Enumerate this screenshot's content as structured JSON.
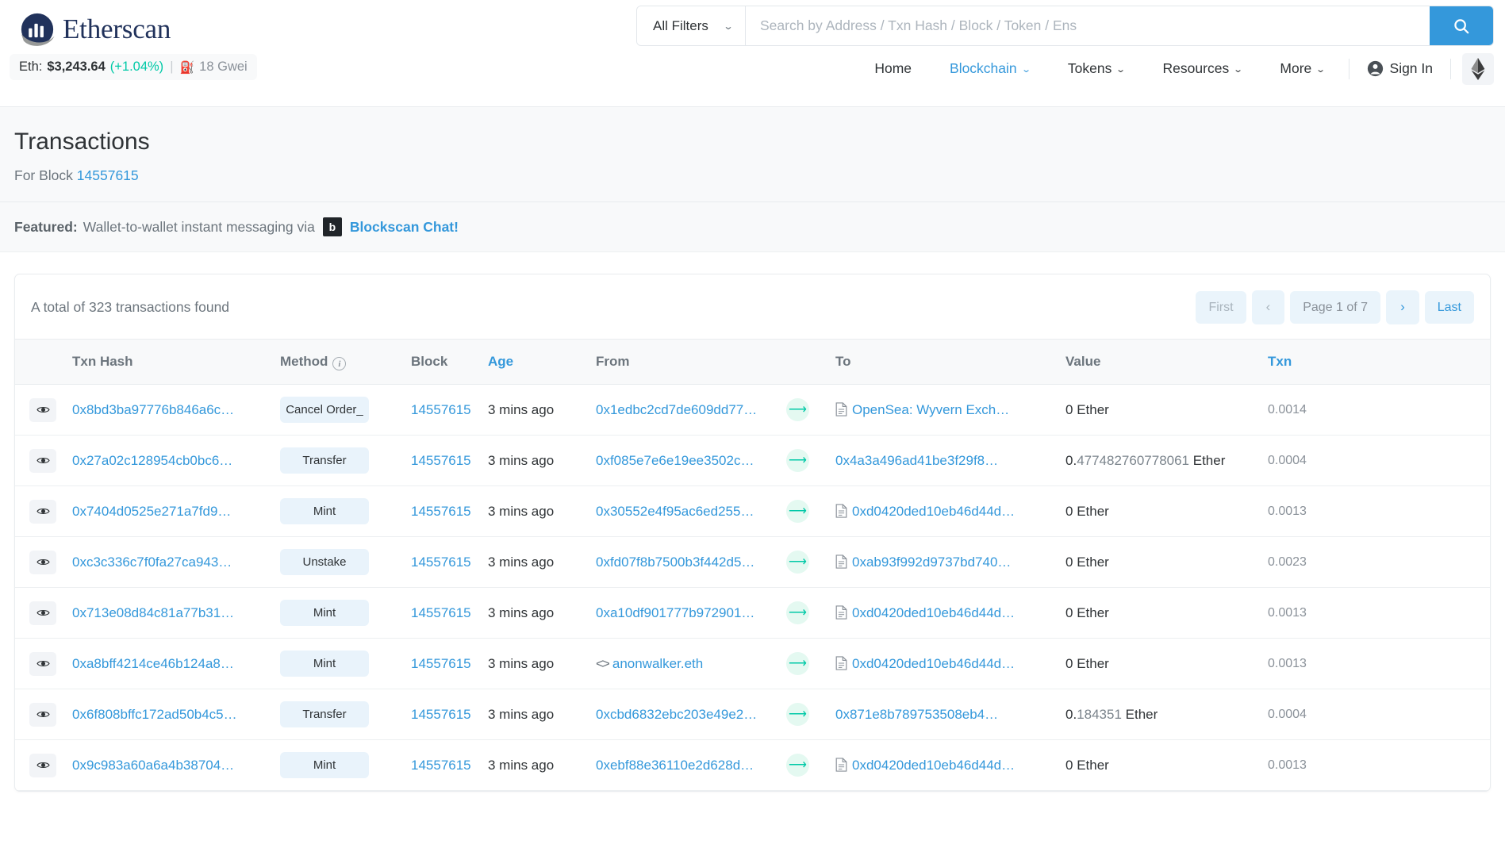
{
  "header": {
    "brand_name": "Etherscan",
    "eth_price": {
      "label": "Eth:",
      "value": "$3,243.64",
      "change": "(+1.04%)",
      "separator": "|",
      "gas": "18 Gwei"
    },
    "search": {
      "filter_label": "All Filters",
      "placeholder": "Search by Address / Txn Hash / Block / Token / Ens",
      "value": ""
    },
    "nav": [
      {
        "label": "Home",
        "has_caret": false,
        "active": false
      },
      {
        "label": "Blockchain",
        "has_caret": true,
        "active": true
      },
      {
        "label": "Tokens",
        "has_caret": true,
        "active": false
      },
      {
        "label": "Resources",
        "has_caret": true,
        "active": false
      },
      {
        "label": "More",
        "has_caret": true,
        "active": false
      }
    ],
    "sign_in_label": "Sign In"
  },
  "page": {
    "title": "Transactions",
    "subtitle_prefix": "For Block",
    "block_number": "14557615"
  },
  "featured": {
    "label": "Featured:",
    "text": "Wallet-to-wallet instant messaging via",
    "logo_letter": "b",
    "link": "Blockscan Chat!"
  },
  "card": {
    "total_text": "A total of 323 transactions found",
    "pagination": {
      "first": "First",
      "prev": "‹",
      "page_info": "Page 1 of 7",
      "next": "›",
      "last": "Last"
    }
  },
  "table": {
    "columns": [
      {
        "key": "eye",
        "label": ""
      },
      {
        "key": "hash",
        "label": "Txn Hash"
      },
      {
        "key": "method",
        "label": "Method",
        "info": true
      },
      {
        "key": "block",
        "label": "Block"
      },
      {
        "key": "age",
        "label": "Age",
        "sortable": true
      },
      {
        "key": "from",
        "label": "From"
      },
      {
        "key": "arrow",
        "label": ""
      },
      {
        "key": "to",
        "label": "To"
      },
      {
        "key": "value",
        "label": "Value"
      },
      {
        "key": "txn",
        "label": "Txn",
        "sortable": true
      }
    ],
    "rows": [
      {
        "hash": "0x8bd3ba97776b846a6c…",
        "method": "Cancel Order_",
        "block": "14557615",
        "age": "3 mins ago",
        "from": "0x1edbc2cd7de609dd77…",
        "from_is_contract": false,
        "to": "OpenSea: Wyvern Exch…",
        "to_is_contract": true,
        "value_lead": "0",
        "value_rest": "",
        "value_unit": "Ether",
        "txn_fee": "0.0014"
      },
      {
        "hash": "0x27a02c128954cb0bc6…",
        "method": "Transfer",
        "block": "14557615",
        "age": "3 mins ago",
        "from": "0xf085e7e6e19ee3502c…",
        "from_is_contract": false,
        "to": "0x4a3a496ad41be3f29f8…",
        "to_is_contract": false,
        "value_lead": "0.",
        "value_rest": "477482760778061",
        "value_unit": "Ether",
        "txn_fee": "0.0004"
      },
      {
        "hash": "0x7404d0525e271a7fd9…",
        "method": "Mint",
        "block": "14557615",
        "age": "3 mins ago",
        "from": "0x30552e4f95ac6ed255…",
        "from_is_contract": false,
        "to": "0xd0420ded10eb46d44d…",
        "to_is_contract": true,
        "value_lead": "0",
        "value_rest": "",
        "value_unit": "Ether",
        "txn_fee": "0.0013"
      },
      {
        "hash": "0xc3c336c7f0fa27ca943…",
        "method": "Unstake",
        "block": "14557615",
        "age": "3 mins ago",
        "from": "0xfd07f8b7500b3f442d5…",
        "from_is_contract": false,
        "to": "0xab93f992d9737bd740…",
        "to_is_contract": true,
        "value_lead": "0",
        "value_rest": "",
        "value_unit": "Ether",
        "txn_fee": "0.0023"
      },
      {
        "hash": "0x713e08d84c81a77b31…",
        "method": "Mint",
        "block": "14557615",
        "age": "3 mins ago",
        "from": "0xa10df901777b972901…",
        "from_is_contract": false,
        "to": "0xd0420ded10eb46d44d…",
        "to_is_contract": true,
        "value_lead": "0",
        "value_rest": "",
        "value_unit": "Ether",
        "txn_fee": "0.0013"
      },
      {
        "hash": "0xa8bff4214ce46b124a8…",
        "method": "Mint",
        "block": "14557615",
        "age": "3 mins ago",
        "from": "anonwalker.eth",
        "from_is_ens": true,
        "from_is_contract": false,
        "to": "0xd0420ded10eb46d44d…",
        "to_is_contract": true,
        "value_lead": "0",
        "value_rest": "",
        "value_unit": "Ether",
        "txn_fee": "0.0013"
      },
      {
        "hash": "0x6f808bffc172ad50b4c5…",
        "method": "Transfer",
        "block": "14557615",
        "age": "3 mins ago",
        "from": "0xcbd6832ebc203e49e2…",
        "from_is_contract": false,
        "to": "0x871e8b789753508eb4…",
        "to_is_contract": false,
        "value_lead": "0.",
        "value_rest": "184351",
        "value_unit": "Ether",
        "txn_fee": "0.0004"
      },
      {
        "hash": "0x9c983a60a6a4b38704…",
        "method": "Mint",
        "block": "14557615",
        "age": "3 mins ago",
        "from": "0xebf88e36110e2d628d…",
        "from_is_contract": false,
        "to": "0xd0420ded10eb46d44d…",
        "to_is_contract": true,
        "value_lead": "0",
        "value_rest": "",
        "value_unit": "Ether",
        "txn_fee": "0.0013"
      }
    ]
  },
  "colors": {
    "brand_navy": "#21325b",
    "link_blue": "#3498db",
    "accent_green": "#00c9a7",
    "badge_bg": "#e9f3fb",
    "muted": "#6c757d"
  }
}
